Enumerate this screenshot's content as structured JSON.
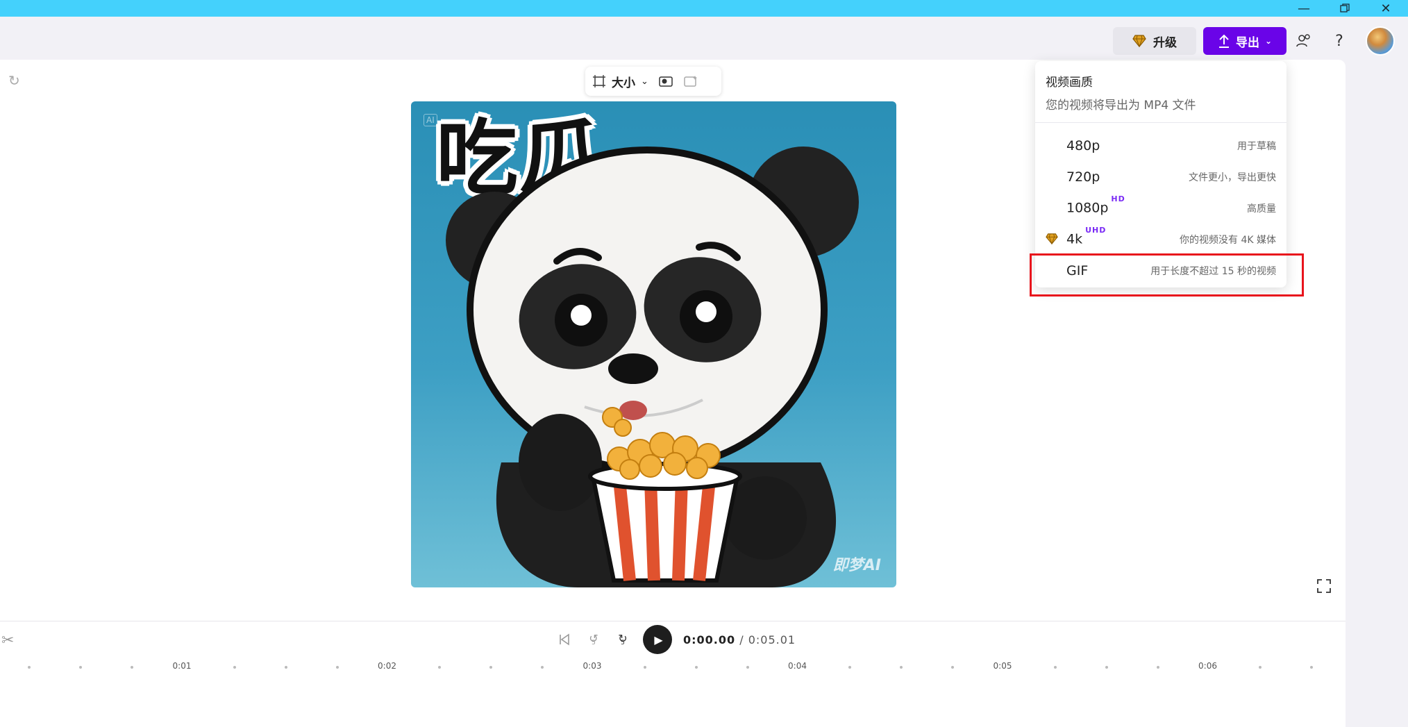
{
  "window": {
    "minimize_icon": "minimize-icon",
    "restore_icon": "restore-icon",
    "close_icon": "close-icon"
  },
  "topbar": {
    "upgrade_label": "升级",
    "export_label": "导出",
    "colors": {
      "export_bg": "#6a04e8",
      "titlebar": "#44d1fc"
    }
  },
  "canvas_toolbar": {
    "size_label": "大小"
  },
  "image": {
    "ai_tag": "AI",
    "sticker_text": "吃瓜",
    "watermark": "即梦AI"
  },
  "player": {
    "current_time": "0:00.00",
    "total_time": "/ 0:05.01",
    "rewind_label": "5",
    "forward_label": "5"
  },
  "timeline": {
    "tick_labels": [
      "0:01",
      "0:02",
      "0:03",
      "0:04",
      "0:05",
      "0:06"
    ]
  },
  "export_menu": {
    "title": "视频画质",
    "subtitle": "您的视频将导出为 MP4 文件",
    "options": [
      {
        "label": "480p",
        "badge": "",
        "desc": "用于草稿"
      },
      {
        "label": "720p",
        "badge": "",
        "desc": "文件更小，导出更快"
      },
      {
        "label": "1080p",
        "badge": "HD",
        "desc": "高质量"
      },
      {
        "label": "4k",
        "badge": "UHD",
        "desc": "你的视频没有 4K 媒体"
      },
      {
        "label": "GIF",
        "badge": "",
        "desc": "用于长度不超过 15 秒的视频"
      }
    ]
  }
}
